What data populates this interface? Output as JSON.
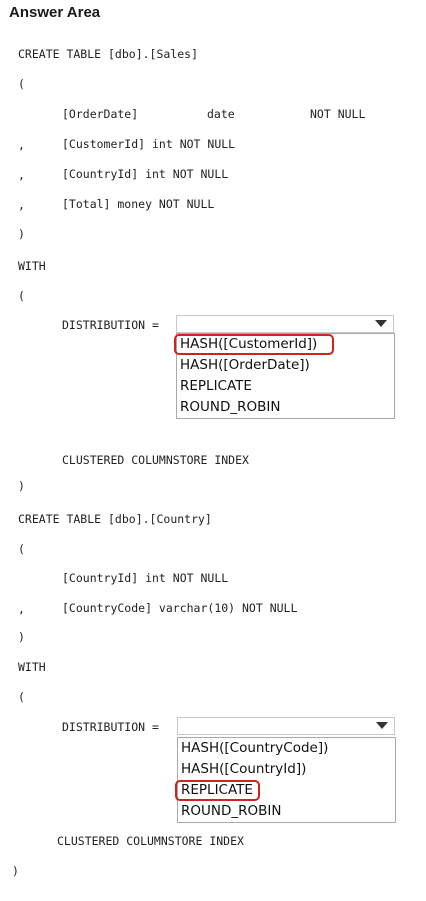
{
  "header": {
    "title": "Answer Area"
  },
  "sales_table": {
    "create": "CREATE TABLE [dbo].[Sales]",
    "open_paren": "(",
    "col1_name": "[OrderDate]",
    "col1_type": "date",
    "col1_null": "NOT NULL",
    "comma": ",",
    "col2": "[CustomerId] int NOT NULL",
    "col3": "[CountryId] int NOT NULL",
    "col4": "[Total] money NOT NULL",
    "close_paren": ")",
    "with": "WITH",
    "with_open": "(",
    "distribution_label": "DISTRIBUTION =",
    "distribution_options": [
      "HASH([CustomerId])",
      "HASH([OrderDate])",
      "REPLICATE",
      "ROUND_ROBIN"
    ],
    "selected_option": "HASH([CustomerId])",
    "index": "CLUSTERED COLUMNSTORE INDEX",
    "with_close": ")"
  },
  "country_table": {
    "create": "CREATE TABLE [dbo].[Country]",
    "open_paren": "(",
    "col1": "[CountryId] int NOT NULL",
    "comma": ",",
    "col2": "[CountryCode] varchar(10) NOT NULL",
    "close_paren": ")",
    "with": "WITH",
    "with_open": "(",
    "distribution_label": "DISTRIBUTION =",
    "distribution_options": [
      "HASH([CountryCode])",
      "HASH([CountryId])",
      "REPLICATE",
      "ROUND_ROBIN"
    ],
    "selected_option": "REPLICATE",
    "index": "CLUSTERED COLUMNSTORE INDEX",
    "with_close": ")"
  }
}
